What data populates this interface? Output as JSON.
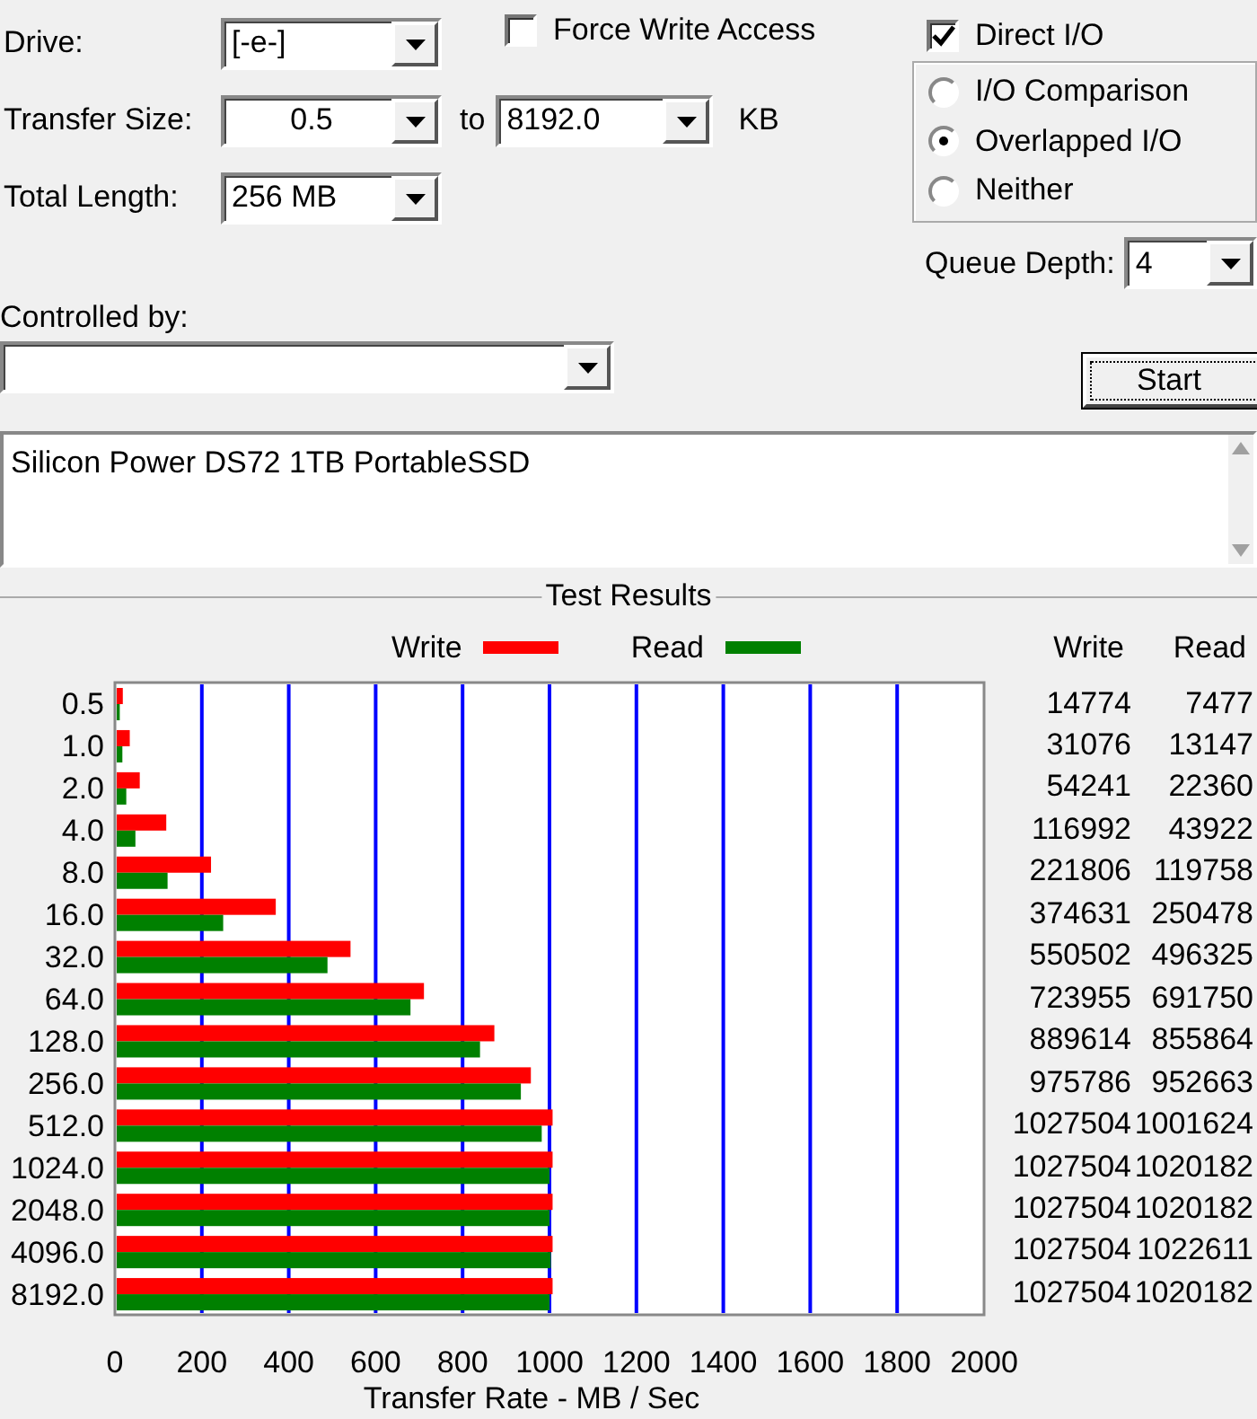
{
  "drive": {
    "label": "Drive:",
    "value": "[-e-]"
  },
  "force_write_access": {
    "label": "Force Write Access",
    "checked": false
  },
  "direct_io": {
    "label": "Direct I/O",
    "checked": true
  },
  "transfer_size": {
    "label": "Transfer Size:",
    "from": "0.5",
    "to_label": "to",
    "to": "8192.0",
    "unit": "KB"
  },
  "total_length": {
    "label": "Total Length:",
    "value": "256 MB"
  },
  "io_mode": [
    {
      "label": "I/O Comparison",
      "selected": false
    },
    {
      "label": "Overlapped I/O",
      "selected": true
    },
    {
      "label": "Neither",
      "selected": false
    }
  ],
  "queue_depth": {
    "label": "Queue Depth:",
    "value": "4"
  },
  "controlled_by": {
    "label": "Controlled by:"
  },
  "start_button": "Start",
  "description": "Silicon Power DS72 1TB PortableSSD",
  "test_results": {
    "title": "Test Results",
    "columns": [
      "Write",
      "Read"
    ],
    "rows": [
      {
        "write": "14774",
        "read": "7477"
      },
      {
        "write": "31076",
        "read": "13147"
      },
      {
        "write": "54241",
        "read": "22360"
      },
      {
        "write": "116992",
        "read": "43922"
      },
      {
        "write": "221806",
        "read": "119758"
      },
      {
        "write": "374631",
        "read": "250478"
      },
      {
        "write": "550502",
        "read": "496325"
      },
      {
        "write": "723955",
        "read": "691750"
      },
      {
        "write": "889614",
        "read": "855864"
      },
      {
        "write": "975786",
        "read": "952663"
      },
      {
        "write": "1027504",
        "read": "1001624"
      },
      {
        "write": "1027504",
        "read": "1020182"
      },
      {
        "write": "1027504",
        "read": "1020182"
      },
      {
        "write": "1027504",
        "read": "1022611"
      },
      {
        "write": "1027504",
        "read": "1020182"
      }
    ],
    "chart_data": {
      "type": "bar",
      "orientation": "horizontal",
      "xlabel": "Transfer Rate - MB / Sec",
      "categories": [
        "0.5",
        "1.0",
        "2.0",
        "4.0",
        "8.0",
        "16.0",
        "32.0",
        "64.0",
        "128.0",
        "256.0",
        "512.0",
        "1024.0",
        "2048.0",
        "4096.0",
        "8192.0"
      ],
      "series": [
        {
          "name": "Write",
          "color": "#ff0000",
          "values": [
            14,
            30,
            53,
            114,
            217,
            366,
            538,
            707,
            869,
            953,
            1003,
            1003,
            1003,
            1003,
            1003
          ]
        },
        {
          "name": "Read",
          "color": "#008000",
          "values": [
            7,
            13,
            22,
            43,
            117,
            245,
            485,
            676,
            836,
            930,
            978,
            996,
            996,
            999,
            996
          ]
        }
      ],
      "grid": true,
      "xlim": [
        0,
        2000
      ],
      "xticks": [
        0,
        200,
        400,
        600,
        800,
        1000,
        1200,
        1400,
        1600,
        1800,
        2000
      ]
    }
  }
}
